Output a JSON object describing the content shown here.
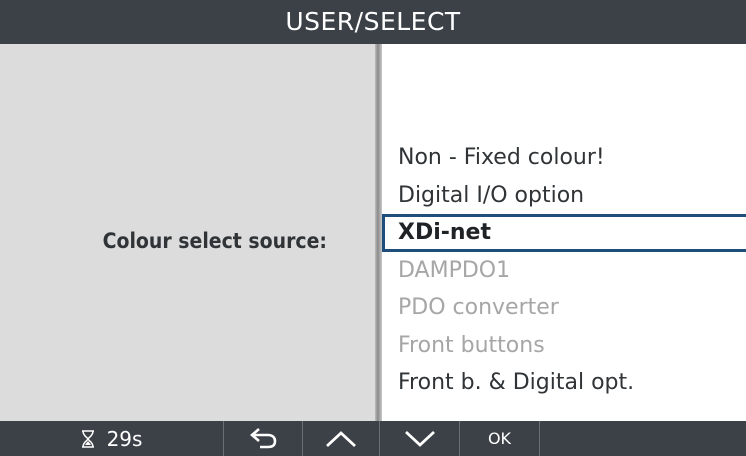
{
  "header": {
    "title": "USER/SELECT"
  },
  "left": {
    "label": "Colour select source:"
  },
  "list": {
    "items": [
      {
        "label": "Non - Fixed colour!",
        "state": "enabled"
      },
      {
        "label": "Digital I/O option",
        "state": "enabled"
      },
      {
        "label": "XDi-net",
        "state": "selected"
      },
      {
        "label": "DAMPDO1",
        "state": "disabled"
      },
      {
        "label": "PDO converter",
        "state": "disabled"
      },
      {
        "label": "Front buttons",
        "state": "disabled"
      },
      {
        "label": "Front b. & Digital opt.",
        "state": "enabled"
      }
    ]
  },
  "footer": {
    "timer": {
      "icon": "hourglass-icon",
      "value": "29s"
    },
    "buttons": [
      {
        "name": "back",
        "icon": "back-arrow-icon"
      },
      {
        "name": "up",
        "icon": "chevron-up-icon"
      },
      {
        "name": "down",
        "icon": "chevron-down-icon"
      },
      {
        "name": "ok",
        "label": "OK"
      }
    ]
  },
  "colors": {
    "header_bg": "#3c4148",
    "footer_bg": "#3c4148",
    "left_panel_bg": "#dcdcdc",
    "selection_border": "#1f4e7a",
    "disabled_text": "#a6a6a6"
  }
}
